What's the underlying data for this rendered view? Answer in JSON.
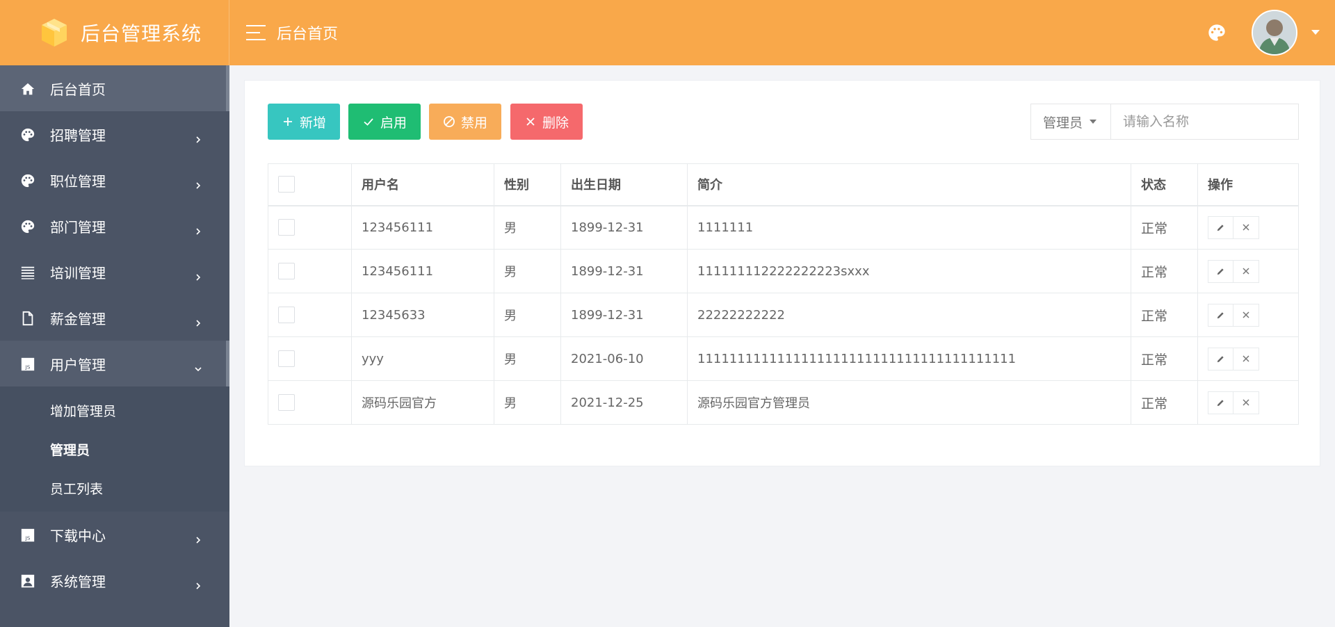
{
  "header": {
    "app_title": "后台管理系统",
    "page_title": "后台首页"
  },
  "sidebar": {
    "items": [
      {
        "label": "后台首页",
        "icon": "home-icon"
      },
      {
        "label": "招聘管理",
        "icon": "palette-icon"
      },
      {
        "label": "职位管理",
        "icon": "palette-icon"
      },
      {
        "label": "部门管理",
        "icon": "palette-icon"
      },
      {
        "label": "培训管理",
        "icon": "list-icon"
      },
      {
        "label": "薪金管理",
        "icon": "file-icon"
      },
      {
        "label": "用户管理",
        "icon": "js-icon"
      },
      {
        "label": "下载中心",
        "icon": "js-icon"
      },
      {
        "label": "系统管理",
        "icon": "id-card-icon"
      }
    ],
    "submenu": [
      "增加管理员",
      "管理员",
      "员工列表"
    ]
  },
  "toolbar": {
    "add": "新增",
    "enable": "启用",
    "disable": "禁用",
    "delete": "删除"
  },
  "search": {
    "selected": "管理员",
    "placeholder": "请输入名称"
  },
  "table": {
    "headers": [
      "用户名",
      "性别",
      "出生日期",
      "简介",
      "状态",
      "操作"
    ],
    "rows": [
      {
        "username": "123456111",
        "gender": "男",
        "birthday": "1899-12-31",
        "intro": "1111111",
        "status": "正常"
      },
      {
        "username": "123456111",
        "gender": "男",
        "birthday": "1899-12-31",
        "intro": "111111112222222223sxxx",
        "status": "正常"
      },
      {
        "username": "12345633",
        "gender": "男",
        "birthday": "1899-12-31",
        "intro": "22222222222",
        "status": "正常"
      },
      {
        "username": "yyy",
        "gender": "男",
        "birthday": "2021-06-10",
        "intro": "1111111111111111111111111111111111111111",
        "status": "正常"
      },
      {
        "username": "源码乐园官方",
        "gender": "男",
        "birthday": "2021-12-25",
        "intro": "源码乐园官方管理员",
        "status": "正常"
      }
    ]
  },
  "colors": {
    "header": "#f9a84a",
    "sidebar": "#4b5465",
    "add": "#37c6c0",
    "enable": "#1fbd73",
    "disable": "#f8ac59",
    "delete": "#f5696c",
    "status": "#1ab394"
  }
}
